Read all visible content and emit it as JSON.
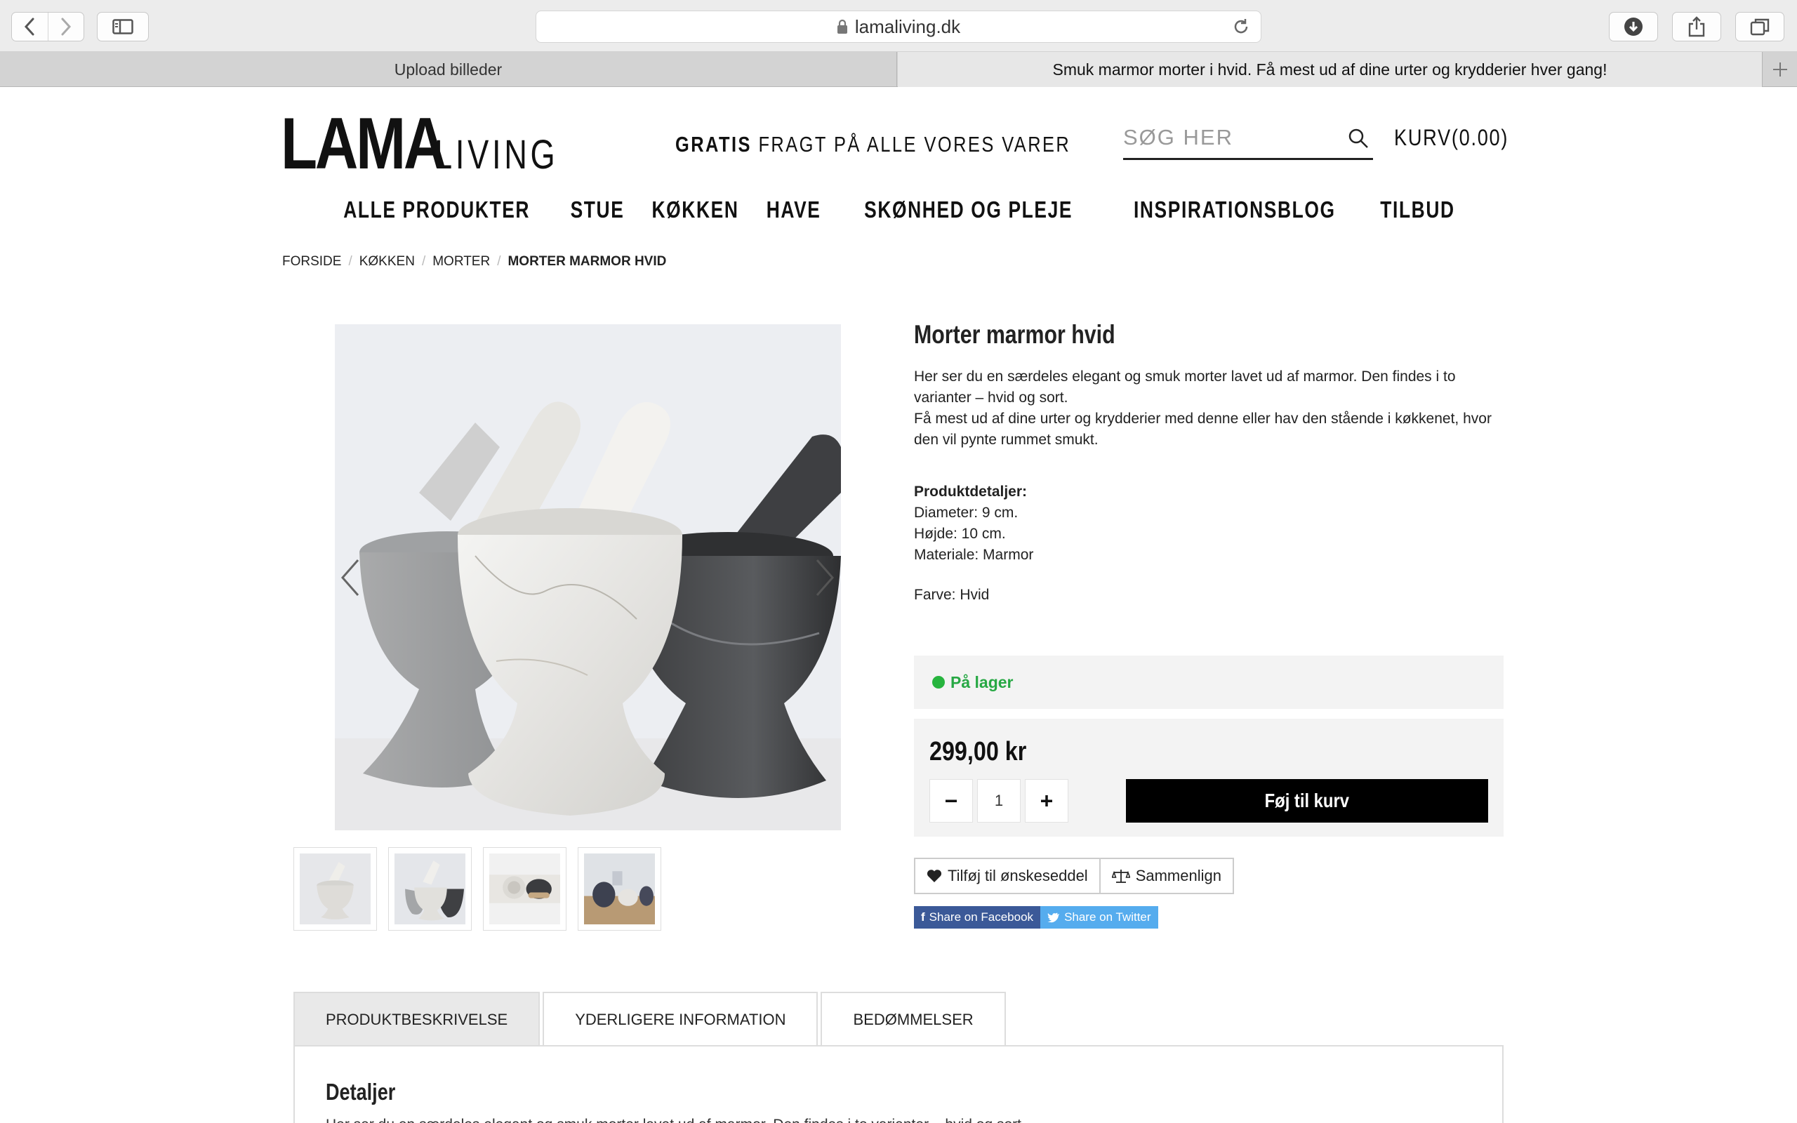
{
  "browser": {
    "url": "lamaliving.dk",
    "tabs": [
      {
        "label": "Upload billeder"
      },
      {
        "label": "Smuk marmor morter i hvid. Få mest ud af dine urter og krydderier hver gang!"
      }
    ]
  },
  "header": {
    "logo_main": "LAMA",
    "logo_sub": "LIVING",
    "freight_bold": "GRATIS",
    "freight_rest": "FRAGT PÅ ALLE VORES VARER",
    "search_placeholder": "SØG HER",
    "cart": "KURV(0.00)"
  },
  "nav": [
    "ALLE PRODUKTER",
    "STUE",
    "KØKKEN",
    "HAVE",
    "SKØNHED OG PLEJE",
    "INSPIRATIONSBLOG",
    "TILBUD"
  ],
  "breadcrumb": [
    "FORSIDE",
    "KØKKEN",
    "MORTER",
    "MORTER MARMOR HVID"
  ],
  "product": {
    "title": "Morter marmor hvid",
    "desc1": "Her ser du en særdeles elegant og smuk morter lavet ud af marmor. Den findes i to varianter – hvid og sort.",
    "desc2": "Få mest ud af dine urter og krydderier med denne eller hav den stående i køkkenet, hvor den vil pynte rummet smukt.",
    "details_heading": "Produktdetaljer:",
    "details": [
      "Diameter: 9 cm.",
      "Højde: 10 cm.",
      "Materiale: Marmor"
    ],
    "color": "Farve: Hvid",
    "stock": "På lager",
    "price": "299,00 kr",
    "quantity": "1",
    "add_to_cart": "Føj til kurv",
    "wishlist": "Tilføj til ønskeseddel",
    "compare": "Sammenlign",
    "share_facebook": "Share on Facebook",
    "share_twitter": "Share on Twitter"
  },
  "tabs": [
    "PRODUKTBESKRIVELSE",
    "YDERLIGERE INFORMATION",
    "BEDØMMELSER"
  ],
  "panel": {
    "title": "Detaljer",
    "text": "Her ser du en særdeles elegant og smuk morter lavet ud af marmor. Den findes i to varianter – hvid og sort."
  },
  "colors": {
    "accent": "#000000",
    "in_stock": "#27a844",
    "facebook": "#3b5998",
    "twitter": "#55acee"
  }
}
